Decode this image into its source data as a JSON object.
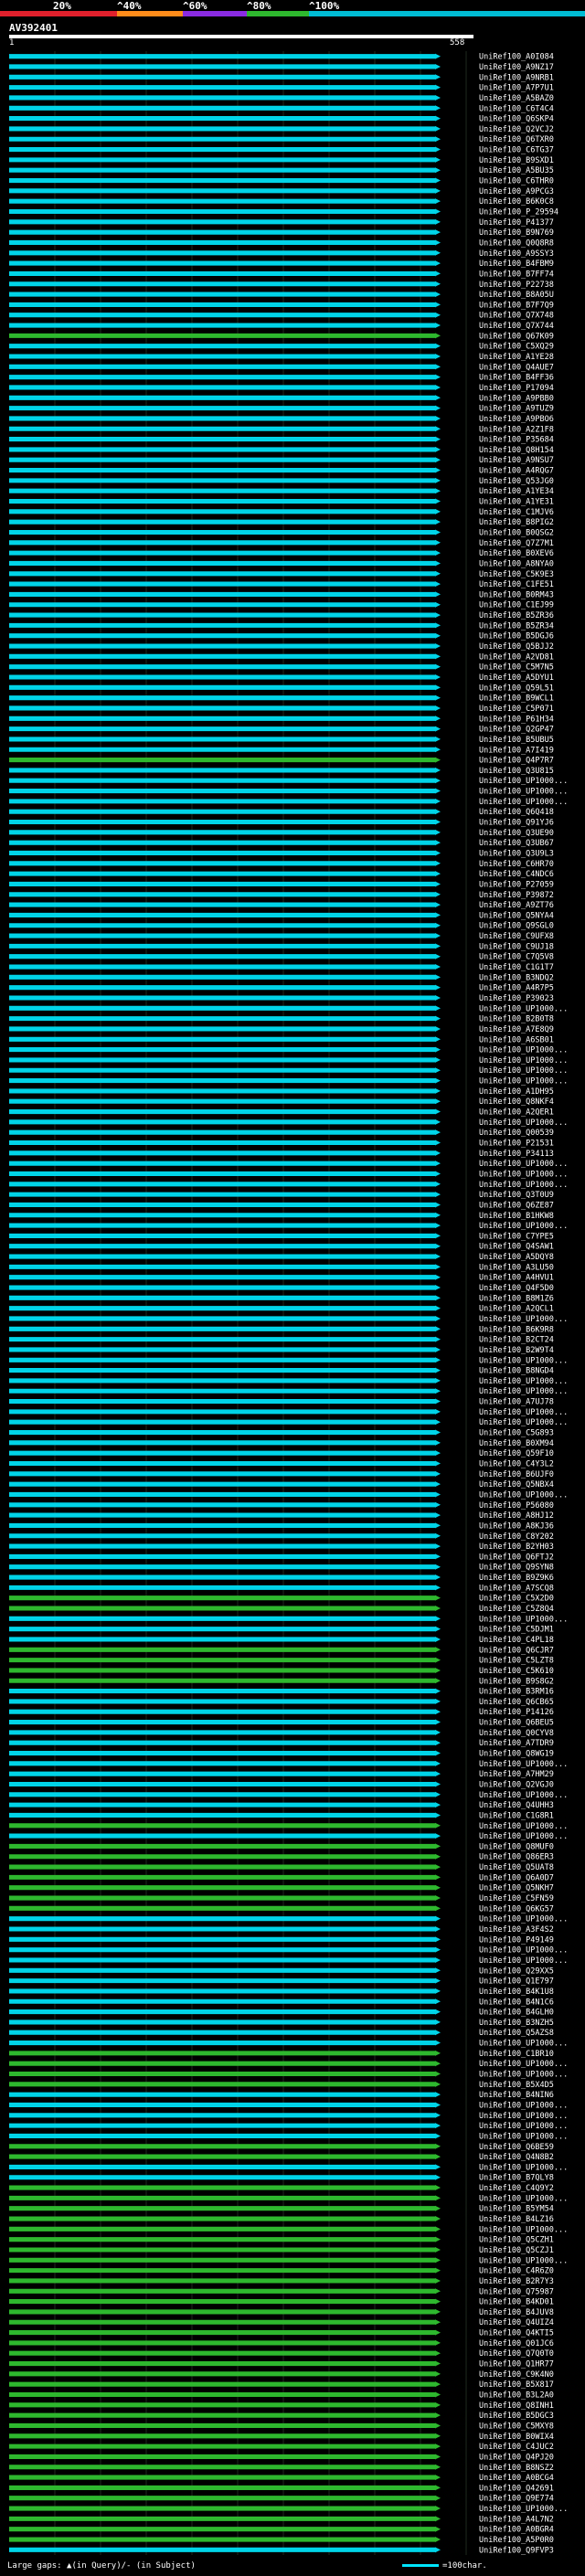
{
  "legend": {
    "labels": [
      "20%",
      "^40%",
      "^60%",
      "^80%",
      "^100%"
    ],
    "colors": [
      "#e0202c",
      "#ff8c1a",
      "#8a2be2",
      "#2eb82e",
      "#00bcd4"
    ]
  },
  "query": {
    "name": "AV392401",
    "start": "1",
    "end": "558"
  },
  "footer": {
    "gaps_text": "Large gaps: ▲(in Query)/- (in Subject)",
    "scale_text": "=100char."
  },
  "hits": [
    {
      "name": "UniRef100_A0I084",
      "pct": "cyan"
    },
    {
      "name": "UniRef100_A9NZ17",
      "pct": "cyan"
    },
    {
      "name": "UniRef100_A9NRB1",
      "pct": "cyan"
    },
    {
      "name": "UniRef100_A7P7U1",
      "pct": "cyan"
    },
    {
      "name": "UniRef100_A5BAZ0",
      "pct": "cyan"
    },
    {
      "name": "UniRef100_C6T4C4",
      "pct": "cyan"
    },
    {
      "name": "UniRef100_Q6SKP4",
      "pct": "cyan"
    },
    {
      "name": "UniRef100_Q2VCJ2",
      "pct": "cyan"
    },
    {
      "name": "UniRef100_Q6TXR0",
      "pct": "cyan"
    },
    {
      "name": "UniRef100_C6TG37",
      "pct": "cyan"
    },
    {
      "name": "UniRef100_B9SXD1",
      "pct": "cyan"
    },
    {
      "name": "UniRef100_A5BU35",
      "pct": "cyan"
    },
    {
      "name": "UniRef100_C6THR0",
      "pct": "cyan"
    },
    {
      "name": "UniRef100_A9PCG3",
      "pct": "cyan"
    },
    {
      "name": "UniRef100_B6K0C8",
      "pct": "cyan"
    },
    {
      "name": "UniRef100_P_29594",
      "pct": "cyan"
    },
    {
      "name": "UniRef100_P41377",
      "pct": "cyan"
    },
    {
      "name": "UniRef100_B9N769",
      "pct": "cyan"
    },
    {
      "name": "UniRef100_Q0Q8R8",
      "pct": "cyan"
    },
    {
      "name": "UniRef100_A9SSY3",
      "pct": "cyan"
    },
    {
      "name": "UniRef100_B4FBM9",
      "pct": "cyan"
    },
    {
      "name": "UniRef100_B7FF74",
      "pct": "cyan"
    },
    {
      "name": "UniRef100_P22738",
      "pct": "cyan"
    },
    {
      "name": "UniRef100_B8A05U",
      "pct": "cyan"
    },
    {
      "name": "UniRef100_B7F7Q9",
      "pct": "cyan"
    },
    {
      "name": "UniRef100_Q7X748",
      "pct": "cyan"
    },
    {
      "name": "UniRef100_Q7X744",
      "pct": "cyan"
    },
    {
      "name": "UniRef100_Q67K09",
      "pct": "green"
    },
    {
      "name": "UniRef100_C5XQ29",
      "pct": "cyan"
    },
    {
      "name": "UniRef100_A1YE28",
      "pct": "cyan"
    },
    {
      "name": "UniRef100_Q4AUE7",
      "pct": "cyan"
    },
    {
      "name": "UniRef100_B4FF36",
      "pct": "cyan"
    },
    {
      "name": "UniRef100_P17094",
      "pct": "cyan"
    },
    {
      "name": "UniRef100_A9PBB0",
      "pct": "cyan"
    },
    {
      "name": "UniRef100_A9TUZ9",
      "pct": "cyan"
    },
    {
      "name": "UniRef100_A9PBO6",
      "pct": "cyan"
    },
    {
      "name": "UniRef100_A2Z1F8",
      "pct": "cyan"
    },
    {
      "name": "UniRef100_P35684",
      "pct": "cyan"
    },
    {
      "name": "UniRef100_Q8H154",
      "pct": "cyan"
    },
    {
      "name": "UniRef100_A9NSU7",
      "pct": "cyan"
    },
    {
      "name": "UniRef100_A4RQG7",
      "pct": "cyan"
    },
    {
      "name": "UniRef100_Q53JG0",
      "pct": "cyan"
    },
    {
      "name": "UniRef100_A1YE34",
      "pct": "cyan"
    },
    {
      "name": "UniRef100_A1YE31",
      "pct": "cyan"
    },
    {
      "name": "UniRef100_C1MJV6",
      "pct": "cyan"
    },
    {
      "name": "UniRef100_B8PIG2",
      "pct": "cyan"
    },
    {
      "name": "UniRef100_B0QSG2",
      "pct": "cyan"
    },
    {
      "name": "UniRef100_Q7Z7M1",
      "pct": "cyan"
    },
    {
      "name": "UniRef100_B0XEV6",
      "pct": "cyan"
    },
    {
      "name": "UniRef100_A8NYA0",
      "pct": "cyan"
    },
    {
      "name": "UniRef100_C5K9E3",
      "pct": "cyan"
    },
    {
      "name": "UniRef100_C1FE51",
      "pct": "cyan"
    },
    {
      "name": "UniRef100_B0RM43",
      "pct": "cyan"
    },
    {
      "name": "UniRef100_C1EJ99",
      "pct": "cyan"
    },
    {
      "name": "UniRef100_B5ZR36",
      "pct": "cyan"
    },
    {
      "name": "UniRef100_B5ZR34",
      "pct": "cyan"
    },
    {
      "name": "UniRef100_B5DGJ6",
      "pct": "cyan"
    },
    {
      "name": "UniRef100_Q5BJJ2",
      "pct": "cyan"
    },
    {
      "name": "UniRef100_A2VD81",
      "pct": "cyan"
    },
    {
      "name": "UniRef100_C5M7N5",
      "pct": "cyan"
    },
    {
      "name": "UniRef100_A5DYU1",
      "pct": "cyan"
    },
    {
      "name": "UniRef100_Q59L51",
      "pct": "cyan"
    },
    {
      "name": "UniRef100_B9WCL1",
      "pct": "cyan"
    },
    {
      "name": "UniRef100_C5P071",
      "pct": "cyan"
    },
    {
      "name": "UniRef100_P61H34",
      "pct": "cyan"
    },
    {
      "name": "UniRef100_Q2GP47",
      "pct": "cyan"
    },
    {
      "name": "UniRef100_B5UBU5",
      "pct": "cyan"
    },
    {
      "name": "UniRef100_A7I419",
      "pct": "cyan"
    },
    {
      "name": "UniRef100_Q4P7R7",
      "pct": "green"
    },
    {
      "name": "UniRef100_Q3U815",
      "pct": "cyan"
    },
    {
      "name": "UniRef100_UP1000...",
      "pct": "cyan"
    },
    {
      "name": "UniRef100_UP1000...",
      "pct": "cyan"
    },
    {
      "name": "UniRef100_UP1000...",
      "pct": "cyan"
    },
    {
      "name": "UniRef100_Q6Q418",
      "pct": "cyan"
    },
    {
      "name": "UniRef100_Q91YJ6",
      "pct": "cyan"
    },
    {
      "name": "UniRef100_Q3UE90",
      "pct": "cyan"
    },
    {
      "name": "UniRef100_Q3UB67",
      "pct": "cyan"
    },
    {
      "name": "UniRef100_Q3U9L3",
      "pct": "cyan"
    },
    {
      "name": "UniRef100_C6HR70",
      "pct": "cyan"
    },
    {
      "name": "UniRef100_C4NDC6",
      "pct": "cyan"
    },
    {
      "name": "UniRef100_P27059",
      "pct": "cyan"
    },
    {
      "name": "UniRef100_P39872",
      "pct": "cyan"
    },
    {
      "name": "UniRef100_A9ZT76",
      "pct": "cyan"
    },
    {
      "name": "UniRef100_Q5NYA4",
      "pct": "cyan"
    },
    {
      "name": "UniRef100_Q9SGL0",
      "pct": "cyan"
    },
    {
      "name": "UniRef100_C9UFX8",
      "pct": "cyan"
    },
    {
      "name": "UniRef100_C9UJ18",
      "pct": "cyan"
    },
    {
      "name": "UniRef100_C7Q5V8",
      "pct": "cyan"
    },
    {
      "name": "UniRef100_C1G1T7",
      "pct": "cyan"
    },
    {
      "name": "UniRef100_B3NDQ2",
      "pct": "cyan"
    },
    {
      "name": "UniRef100_A4R7P5",
      "pct": "cyan"
    },
    {
      "name": "UniRef100_P39023",
      "pct": "cyan"
    },
    {
      "name": "UniRef100_UP1000...",
      "pct": "cyan"
    },
    {
      "name": "UniRef100_B2B0T8",
      "pct": "cyan"
    },
    {
      "name": "UniRef100_A7E8Q9",
      "pct": "cyan"
    },
    {
      "name": "UniRef100_A6SB01",
      "pct": "cyan"
    },
    {
      "name": "UniRef100_UP1000...",
      "pct": "cyan"
    },
    {
      "name": "UniRef100_UP1000...",
      "pct": "cyan"
    },
    {
      "name": "UniRef100_UP1000...",
      "pct": "cyan"
    },
    {
      "name": "UniRef100_UP1000...",
      "pct": "cyan"
    },
    {
      "name": "UniRef100_A1DH95",
      "pct": "cyan"
    },
    {
      "name": "UniRef100_Q8NKF4",
      "pct": "cyan"
    },
    {
      "name": "UniRef100_A2QER1",
      "pct": "cyan"
    },
    {
      "name": "UniRef100_UP1000...",
      "pct": "cyan"
    },
    {
      "name": "UniRef100_Q00539",
      "pct": "cyan"
    },
    {
      "name": "UniRef100_P21531",
      "pct": "cyan"
    },
    {
      "name": "UniRef100_P34113",
      "pct": "cyan"
    },
    {
      "name": "UniRef100_UP1000...",
      "pct": "cyan"
    },
    {
      "name": "UniRef100_UP1000...",
      "pct": "cyan"
    },
    {
      "name": "UniRef100_UP1000...",
      "pct": "cyan"
    },
    {
      "name": "UniRef100_Q3T0U9",
      "pct": "cyan"
    },
    {
      "name": "UniRef100_Q6ZE87",
      "pct": "cyan"
    },
    {
      "name": "UniRef100_B1HKW8",
      "pct": "cyan"
    },
    {
      "name": "UniRef100_UP1000...",
      "pct": "cyan"
    },
    {
      "name": "UniRef100_C7YPE5",
      "pct": "cyan"
    },
    {
      "name": "UniRef100_Q4SAW1",
      "pct": "cyan"
    },
    {
      "name": "UniRef100_A5DQY8",
      "pct": "cyan"
    },
    {
      "name": "UniRef100_A3LU50",
      "pct": "cyan"
    },
    {
      "name": "UniRef100_A4HVU1",
      "pct": "cyan"
    },
    {
      "name": "UniRef100_Q4F5D0",
      "pct": "cyan"
    },
    {
      "name": "UniRef100_B8M1Z6",
      "pct": "cyan"
    },
    {
      "name": "UniRef100_A2QCL1",
      "pct": "cyan"
    },
    {
      "name": "UniRef100_UP1000...",
      "pct": "cyan"
    },
    {
      "name": "UniRef100_B6K9R8",
      "pct": "cyan"
    },
    {
      "name": "UniRef100_B2CT24",
      "pct": "cyan"
    },
    {
      "name": "UniRef100_B2W9T4",
      "pct": "cyan"
    },
    {
      "name": "UniRef100_UP1000...",
      "pct": "cyan"
    },
    {
      "name": "UniRef100_B8NGD4",
      "pct": "cyan"
    },
    {
      "name": "UniRef100_UP1000...",
      "pct": "cyan"
    },
    {
      "name": "UniRef100_UP1000...",
      "pct": "cyan"
    },
    {
      "name": "UniRef100_A7UJ78",
      "pct": "cyan"
    },
    {
      "name": "UniRef100_UP1000...",
      "pct": "cyan"
    },
    {
      "name": "UniRef100_UP1000...",
      "pct": "cyan"
    },
    {
      "name": "UniRef100_C5G893",
      "pct": "cyan"
    },
    {
      "name": "UniRef100_B0XM94",
      "pct": "cyan"
    },
    {
      "name": "UniRef100_Q59F10",
      "pct": "cyan"
    },
    {
      "name": "UniRef100_C4Y3L2",
      "pct": "cyan"
    },
    {
      "name": "UniRef100_B6UJF0",
      "pct": "cyan"
    },
    {
      "name": "UniRef100_Q5NBX4",
      "pct": "cyan"
    },
    {
      "name": "UniRef100_UP1000...",
      "pct": "cyan"
    },
    {
      "name": "UniRef100_P56080",
      "pct": "cyan"
    },
    {
      "name": "UniRef100_A8HJ12",
      "pct": "cyan"
    },
    {
      "name": "UniRef100_A8KJ36",
      "pct": "cyan"
    },
    {
      "name": "UniRef100_C8Y202",
      "pct": "cyan"
    },
    {
      "name": "UniRef100_B2YH03",
      "pct": "cyan"
    },
    {
      "name": "UniRef100_Q6FTJ2",
      "pct": "cyan"
    },
    {
      "name": "UniRef100_Q9SYN8",
      "pct": "cyan"
    },
    {
      "name": "UniRef100_B9Z9K6",
      "pct": "cyan"
    },
    {
      "name": "UniRef100_A7SCQ8",
      "pct": "cyan"
    },
    {
      "name": "UniRef100_C5X2D0",
      "pct": "green"
    },
    {
      "name": "UniRef100_C5Z8Q4",
      "pct": "green"
    },
    {
      "name": "UniRef100_UP1000...",
      "pct": "cyan"
    },
    {
      "name": "UniRef100_C5DJM1",
      "pct": "cyan"
    },
    {
      "name": "UniRef100_C4PL18",
      "pct": "cyan"
    },
    {
      "name": "UniRef100_Q6CJR7",
      "pct": "green"
    },
    {
      "name": "UniRef100_C5LZT8",
      "pct": "green"
    },
    {
      "name": "UniRef100_C5K610",
      "pct": "green"
    },
    {
      "name": "UniRef100_B9S8G2",
      "pct": "green"
    },
    {
      "name": "UniRef100_B3RM16",
      "pct": "cyan"
    },
    {
      "name": "UniRef100_Q6CB65",
      "pct": "cyan"
    },
    {
      "name": "UniRef100_P14126",
      "pct": "cyan"
    },
    {
      "name": "UniRef100_Q6BEU5",
      "pct": "cyan"
    },
    {
      "name": "UniRef100_Q0CYV8",
      "pct": "cyan"
    },
    {
      "name": "UniRef100_A7TDR9",
      "pct": "cyan"
    },
    {
      "name": "UniRef100_Q8WG19",
      "pct": "cyan"
    },
    {
      "name": "UniRef100_UP1000...",
      "pct": "cyan"
    },
    {
      "name": "UniRef100_A7HM29",
      "pct": "cyan"
    },
    {
      "name": "UniRef100_Q2VGJ0",
      "pct": "cyan"
    },
    {
      "name": "UniRef100_UP1000...",
      "pct": "cyan"
    },
    {
      "name": "UniRef100_Q4UHH3",
      "pct": "cyan"
    },
    {
      "name": "UniRef100_C1G8R1",
      "pct": "cyan"
    },
    {
      "name": "UniRef100_UP1000...",
      "pct": "green"
    },
    {
      "name": "UniRef100_UP1000...",
      "pct": "cyan"
    },
    {
      "name": "UniRef100_Q8MUF0",
      "pct": "green"
    },
    {
      "name": "UniRef100_Q86ER3",
      "pct": "green"
    },
    {
      "name": "UniRef100_Q5UAT8",
      "pct": "green"
    },
    {
      "name": "UniRef100_Q6A0D7",
      "pct": "green"
    },
    {
      "name": "UniRef100_Q5NKH7",
      "pct": "green"
    },
    {
      "name": "UniRef100_C5FN59",
      "pct": "green"
    },
    {
      "name": "UniRef100_Q6KG57",
      "pct": "green"
    },
    {
      "name": "UniRef100_UP1000...",
      "pct": "cyan"
    },
    {
      "name": "UniRef100_A3F4S2",
      "pct": "cyan"
    },
    {
      "name": "UniRef100_P49149",
      "pct": "cyan"
    },
    {
      "name": "UniRef100_UP1000...",
      "pct": "cyan"
    },
    {
      "name": "UniRef100_UP1000...",
      "pct": "cyan"
    },
    {
      "name": "UniRef100_Q29XX5",
      "pct": "cyan"
    },
    {
      "name": "UniRef100_Q1E797",
      "pct": "cyan"
    },
    {
      "name": "UniRef100_B4K1U8",
      "pct": "cyan"
    },
    {
      "name": "UniRef100_B4N1C6",
      "pct": "cyan"
    },
    {
      "name": "UniRef100_B4GLH0",
      "pct": "cyan"
    },
    {
      "name": "UniRef100_B3NZH5",
      "pct": "cyan"
    },
    {
      "name": "UniRef100_Q5AZS8",
      "pct": "cyan"
    },
    {
      "name": "UniRef100_UP1000...",
      "pct": "cyan"
    },
    {
      "name": "UniRef100_C1BR10",
      "pct": "green"
    },
    {
      "name": "UniRef100_UP1000...",
      "pct": "green"
    },
    {
      "name": "UniRef100_UP1000...",
      "pct": "green"
    },
    {
      "name": "UniRef100_B5X4D5",
      "pct": "green"
    },
    {
      "name": "UniRef100_B4NIN6",
      "pct": "cyan"
    },
    {
      "name": "UniRef100_UP1000...",
      "pct": "cyan"
    },
    {
      "name": "UniRef100_UP1000...",
      "pct": "cyan"
    },
    {
      "name": "UniRef100_UP1000...",
      "pct": "cyan"
    },
    {
      "name": "UniRef100_UP1000...",
      "pct": "cyan"
    },
    {
      "name": "UniRef100_Q6BE59",
      "pct": "green"
    },
    {
      "name": "UniRef100_Q4N8B2",
      "pct": "green"
    },
    {
      "name": "UniRef100_UP1000...",
      "pct": "cyan"
    },
    {
      "name": "UniRef100_B7QLY8",
      "pct": "cyan"
    },
    {
      "name": "UniRef100_C4Q9Y2",
      "pct": "green"
    },
    {
      "name": "UniRef100_UP1000...",
      "pct": "green"
    },
    {
      "name": "UniRef100_B5YM54",
      "pct": "green"
    },
    {
      "name": "UniRef100_B4LZ16",
      "pct": "green"
    },
    {
      "name": "UniRef100_UP1000...",
      "pct": "green"
    },
    {
      "name": "UniRef100_Q5CZH1",
      "pct": "green"
    },
    {
      "name": "UniRef100_Q5CZJ1",
      "pct": "green"
    },
    {
      "name": "UniRef100_UP1000...",
      "pct": "green"
    },
    {
      "name": "UniRef100_C4R6Z0",
      "pct": "green"
    },
    {
      "name": "UniRef100_B2R7Y3",
      "pct": "green"
    },
    {
      "name": "UniRef100_Q75987",
      "pct": "green"
    },
    {
      "name": "UniRef100_B4KD01",
      "pct": "green"
    },
    {
      "name": "UniRef100_B4JUV8",
      "pct": "green"
    },
    {
      "name": "UniRef100_Q4UIZ4",
      "pct": "green"
    },
    {
      "name": "UniRef100_Q4KTI5",
      "pct": "green"
    },
    {
      "name": "UniRef100_Q01JC6",
      "pct": "green"
    },
    {
      "name": "UniRef100_Q7Q0T0",
      "pct": "green"
    },
    {
      "name": "UniRef100_Q1HR77",
      "pct": "green"
    },
    {
      "name": "UniRef100_C9K4N0",
      "pct": "green"
    },
    {
      "name": "UniRef100_B5X817",
      "pct": "green"
    },
    {
      "name": "UniRef100_B3L2A0",
      "pct": "green"
    },
    {
      "name": "UniRef100_Q8INH1",
      "pct": "green"
    },
    {
      "name": "UniRef100_B5DGC3",
      "pct": "green"
    },
    {
      "name": "UniRef100_C5MXY8",
      "pct": "green"
    },
    {
      "name": "UniRef100_B0WIX4",
      "pct": "green"
    },
    {
      "name": "UniRef100_C4JUC2",
      "pct": "green"
    },
    {
      "name": "UniRef100_Q4PJ20",
      "pct": "green"
    },
    {
      "name": "UniRef100_B8NSZ2",
      "pct": "green"
    },
    {
      "name": "UniRef100_A0BCG4",
      "pct": "green"
    },
    {
      "name": "UniRef100_Q42691",
      "pct": "green"
    },
    {
      "name": "UniRef100_Q9E774",
      "pct": "green"
    },
    {
      "name": "UniRef100_UP1000...",
      "pct": "green"
    },
    {
      "name": "UniRef100_A4L7N2",
      "pct": "green"
    },
    {
      "name": "UniRef100_A0BGR4",
      "pct": "green"
    },
    {
      "name": "UniRef100_A5P0R0",
      "pct": "green"
    },
    {
      "name": "UniRef100_Q9FVP3",
      "pct": "cyan"
    }
  ]
}
